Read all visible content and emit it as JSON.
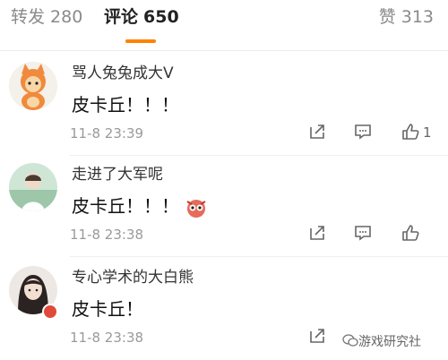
{
  "tabs": {
    "repost_label": "转发",
    "repost_count": "280",
    "comments_label": "评论",
    "comments_count": "650",
    "likes_label": "赞",
    "likes_count": "313"
  },
  "comments": [
    {
      "username": "骂人兔兔成大V",
      "content": "皮卡丘！！！",
      "time": "11-8 23:39",
      "like_count": "1"
    },
    {
      "username": "走进了大军呢",
      "content": "皮卡丘！！！",
      "time": "11-8 23:38",
      "like_count": ""
    },
    {
      "username": "专心学术的大白熊",
      "content": "皮卡丘！",
      "time": "11-8 23:38",
      "like_count": ""
    }
  ],
  "watermark": "游戏研究社",
  "colors": {
    "accent": "#ff8200",
    "text": "#111111",
    "muted": "#9a9a9a"
  },
  "icons": [
    "share-icon",
    "comment-icon",
    "thumbs-up-icon",
    "emoji-icon",
    "badge-icon",
    "wechat-icon"
  ]
}
